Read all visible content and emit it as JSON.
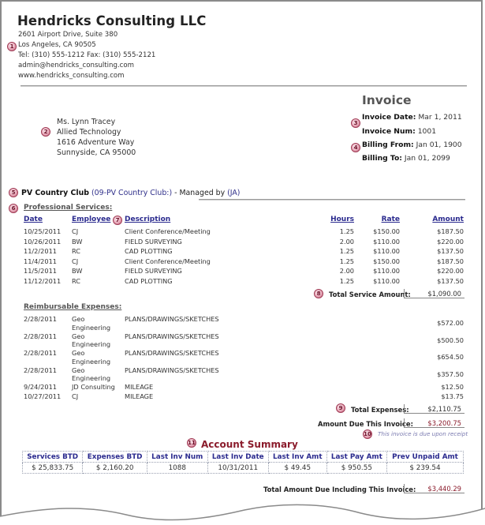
{
  "company": {
    "name": "Hendricks Consulting LLC",
    "address1": "2601 Airport Drive, Suite 380",
    "address2": "Los Angeles, CA 90505",
    "phone_fax": "Tel: (310) 555-1212 Fax: (310) 555-2121",
    "email": "admin@hendricks_consulting.com",
    "website": "www.hendricks_consulting.com"
  },
  "client": {
    "contact": "Ms. Lynn Tracey",
    "company": "Allied Technology",
    "street": "1616 Adventure Way",
    "city": "Sunnyside, CA 95000"
  },
  "invoice": {
    "title": "Invoice",
    "date_label": "Invoice Date:",
    "date": "Mar 1, 2011",
    "num_label": "Invoice Num:",
    "num": "1001",
    "billing_from_label": "Billing From:",
    "billing_from": "Jan 01, 1900",
    "billing_to_label": "Billing To:",
    "billing_to": "Jan 01, 2099"
  },
  "project": {
    "name": "PV Country Club",
    "code_link": "(09-PV Country Club:)",
    "managed_by_text": " - Managed by ",
    "manager_link": "(JA)"
  },
  "professional_services": {
    "title": "Professional Services:",
    "headers": {
      "date": "Date",
      "employee": "Employee",
      "description": "Description",
      "hours": "Hours",
      "rate": "Rate",
      "amount": "Amount"
    },
    "rows": [
      {
        "date": "10/25/2011",
        "employee": "CJ",
        "description": "Client Conference/Meeting",
        "hours": "1.25",
        "rate": "$150.00",
        "amount": "$187.50"
      },
      {
        "date": "10/26/2011",
        "employee": "BW",
        "description": "FIELD SURVEYING",
        "hours": "2.00",
        "rate": "$110.00",
        "amount": "$220.00"
      },
      {
        "date": "11/2/2011",
        "employee": "RC",
        "description": "CAD PLOTTING",
        "hours": "1.25",
        "rate": "$110.00",
        "amount": "$137.50"
      },
      {
        "date": "11/4/2011",
        "employee": "CJ",
        "description": "Client Conference/Meeting",
        "hours": "1.25",
        "rate": "$150.00",
        "amount": "$187.50"
      },
      {
        "date": "11/5/2011",
        "employee": "BW",
        "description": "FIELD SURVEYING",
        "hours": "2.00",
        "rate": "$110.00",
        "amount": "$220.00"
      },
      {
        "date": "11/12/2011",
        "employee": "RC",
        "description": "CAD PLOTTING",
        "hours": "1.25",
        "rate": "$110.00",
        "amount": "$137.50"
      }
    ],
    "total_label": "Total Service Amount:",
    "total": "$1,090.00"
  },
  "reimbursable_expenses": {
    "title": "Reimbursable Expenses:",
    "rows": [
      {
        "date": "2/28/2011",
        "employee": [
          "Geo",
          "Engineering"
        ],
        "description": "PLANS/DRAWINGS/SKETCHES",
        "amount": "$572.00"
      },
      {
        "date": "2/28/2011",
        "employee": [
          "Geo",
          "Engineering"
        ],
        "description": "PLANS/DRAWINGS/SKETCHES",
        "amount": "$500.50"
      },
      {
        "date": "2/28/2011",
        "employee": [
          "Geo",
          "Engineering"
        ],
        "description": "PLANS/DRAWINGS/SKETCHES",
        "amount": "$654.50"
      },
      {
        "date": "2/28/2011",
        "employee": [
          "Geo",
          "Engineering"
        ],
        "description": "PLANS/DRAWINGS/SKETCHES",
        "amount": "$357.50"
      },
      {
        "date": "9/24/2011",
        "employee": [
          "JD Consulting"
        ],
        "description": "MILEAGE",
        "amount": "$12.50"
      },
      {
        "date": "10/27/2011",
        "employee": [
          "CJ"
        ],
        "description": "MILEAGE",
        "amount": "$13.75"
      }
    ],
    "total_label": "Total Expenses:",
    "total": "$2,110.75"
  },
  "amount_due": {
    "label": "Amount Due This Invoice:",
    "value": "$3,200.75",
    "note": "This invoice is due upon receipt"
  },
  "account_summary": {
    "title": "Account Summary",
    "headers": [
      "Services BTD",
      "Expenses BTD",
      "Last Inv Num",
      "Last Inv Date",
      "Last Inv Amt",
      "Last Pay Amt",
      "Prev Unpaid Amt"
    ],
    "values": [
      "$ 25,833.75",
      "$ 2,160.20",
      "1088",
      "10/31/2011",
      "$ 49.45",
      "$ 950.55",
      "$ 239.54"
    ]
  },
  "grand_total": {
    "label": "Total Amount Due Including This Invoice:",
    "value": "$3,440.29"
  },
  "callouts": [
    "1",
    "2",
    "3",
    "4",
    "5",
    "6",
    "7",
    "8",
    "9",
    "10",
    "11"
  ],
  "colors": {
    "accent_red": "#8b1c2c",
    "link_blue": "#2a2a8e"
  }
}
